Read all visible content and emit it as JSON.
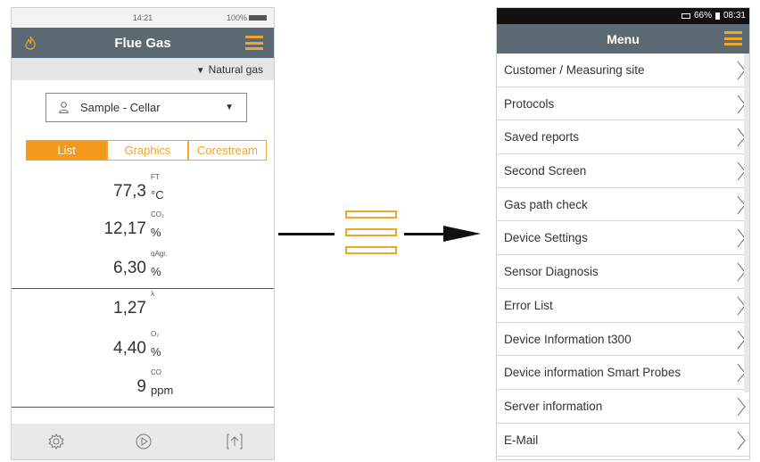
{
  "left_phone": {
    "status": {
      "time": "14:21",
      "battery": "100%"
    },
    "title": "Flue Gas",
    "fuel": "Natural gas",
    "sample_select": "Sample - Cellar",
    "tabs": [
      "List",
      "Graphics",
      "Corestream"
    ],
    "measurements": [
      {
        "value": "77,3",
        "label": "FT",
        "unit": "°C"
      },
      {
        "value": "12,17",
        "label": "CO₂",
        "unit": "%"
      },
      {
        "value": "6,30",
        "label": "qAgr.",
        "unit": "%"
      },
      {
        "value": "1,27",
        "label": "λ",
        "unit": ""
      },
      {
        "value": "4,40",
        "label": "O₂",
        "unit": "%"
      },
      {
        "value": "9",
        "label": "CO",
        "unit": "ppm"
      }
    ],
    "bottom_icons": [
      "gear-icon",
      "play-icon",
      "export-icon"
    ]
  },
  "right_phone": {
    "status": {
      "battery": "66%",
      "time": "08:31"
    },
    "title": "Menu",
    "menu_items": [
      "Customer / Measuring site",
      "Protocols",
      "Saved reports",
      "Second Screen",
      "Gas path check",
      "Device Settings",
      "Sensor Diagnosis",
      "Error List",
      "Device Information t300",
      "Device information Smart Probes",
      "Server information",
      "E-Mail"
    ]
  },
  "colors": {
    "accent": "#f0a52b",
    "header": "#5b6a72"
  }
}
